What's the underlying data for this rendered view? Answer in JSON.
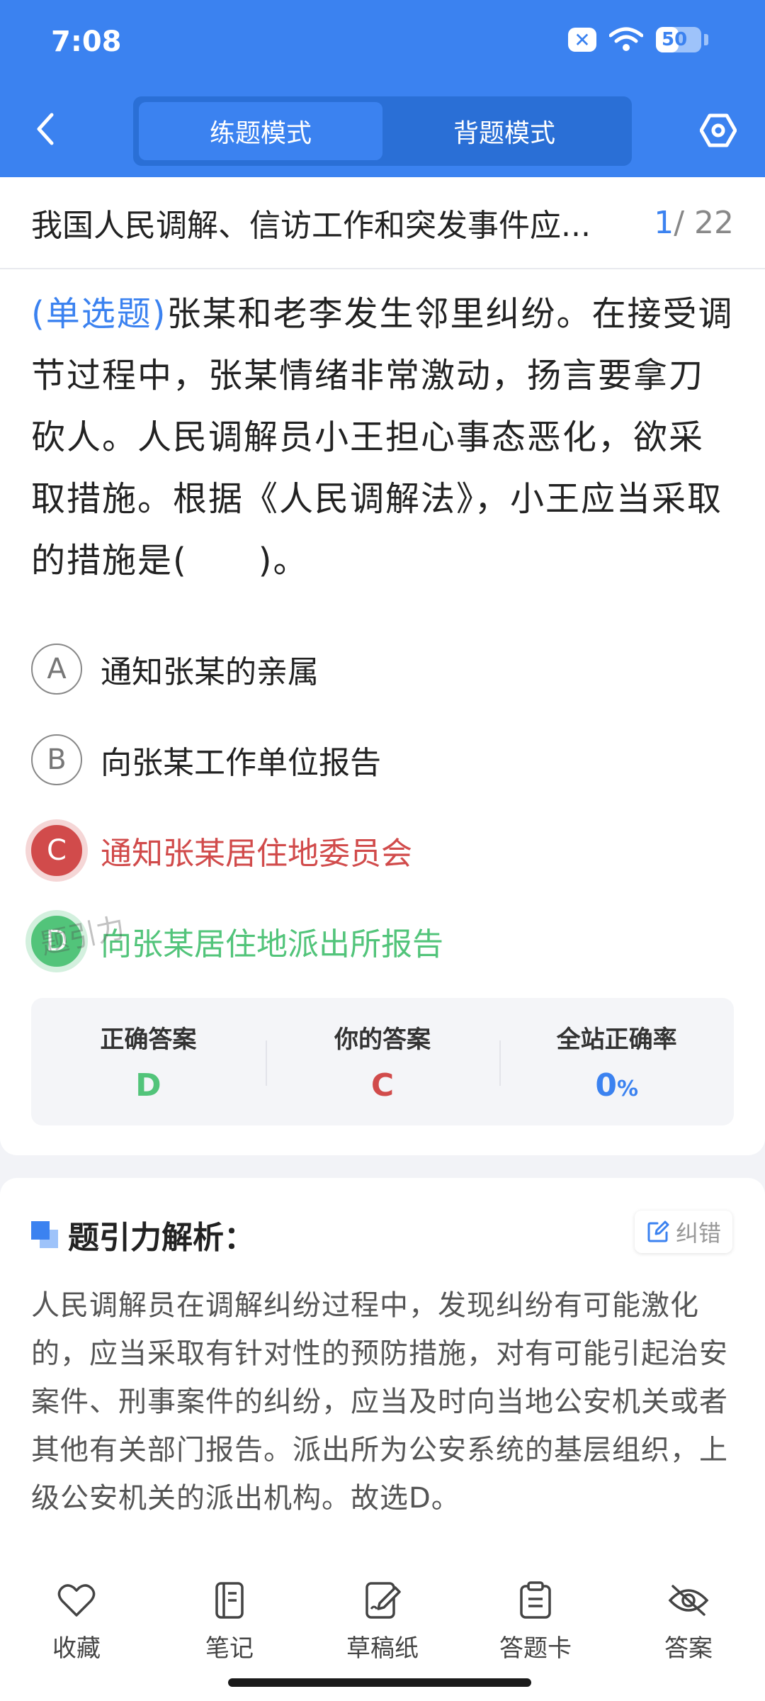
{
  "status_bar": {
    "time": "7:08",
    "battery": "50",
    "battery_level": 0.5
  },
  "header": {
    "modes": [
      {
        "label": "练题模式",
        "active": true
      },
      {
        "label": "背题模式",
        "active": false
      }
    ]
  },
  "question": {
    "title": "我国人民调解、信访工作和突发事件应...",
    "current": "1",
    "total": "/ 22",
    "type_label": "(单选题)",
    "text": "张某和老李发生邻里纠纷。在接受调节过程中，张某情绪非常激动，扬言要拿刀砍人。人民调解员小王担心事态恶化，欲采取措施。根据《人民调解法》，小王应当采取的措施是(　　)。",
    "options": [
      {
        "key": "A",
        "text": "通知张某的亲属",
        "state": "normal"
      },
      {
        "key": "B",
        "text": "向张某工作单位报告",
        "state": "normal"
      },
      {
        "key": "C",
        "text": "通知张某居住地委员会",
        "state": "wrong"
      },
      {
        "key": "D",
        "text": "向张某居住地派出所报告",
        "state": "correct"
      }
    ],
    "watermark": "题引力"
  },
  "answer_summary": {
    "correct_label": "正确答案",
    "correct_value": "D",
    "yours_label": "你的答案",
    "yours_value": "C",
    "rate_label": "全站正确率",
    "rate_value": "0",
    "rate_unit": "%"
  },
  "analysis": {
    "title": "题引力解析：",
    "report_label": "纠错",
    "text": "人民调解员在调解纠纷过程中，发现纠纷有可能激化的，应当采取有针对性的预防措施，对有可能引起治安案件、刑事案件的纠纷，应当及时向当地公安机关或者其他有关部门报告。派出所为公安系统的基层组织，上级公安机关的派出机构。故选D。"
  },
  "bottom_nav": [
    {
      "label": "收藏",
      "icon": "heart-icon"
    },
    {
      "label": "笔记",
      "icon": "notebook-icon"
    },
    {
      "label": "草稿纸",
      "icon": "draft-icon"
    },
    {
      "label": "答题卡",
      "icon": "answer-card-icon"
    },
    {
      "label": "答案",
      "icon": "eye-off-icon"
    }
  ],
  "colors": {
    "primary": "#3b82f0",
    "correct": "#52c47a",
    "wrong": "#d14b4b"
  }
}
